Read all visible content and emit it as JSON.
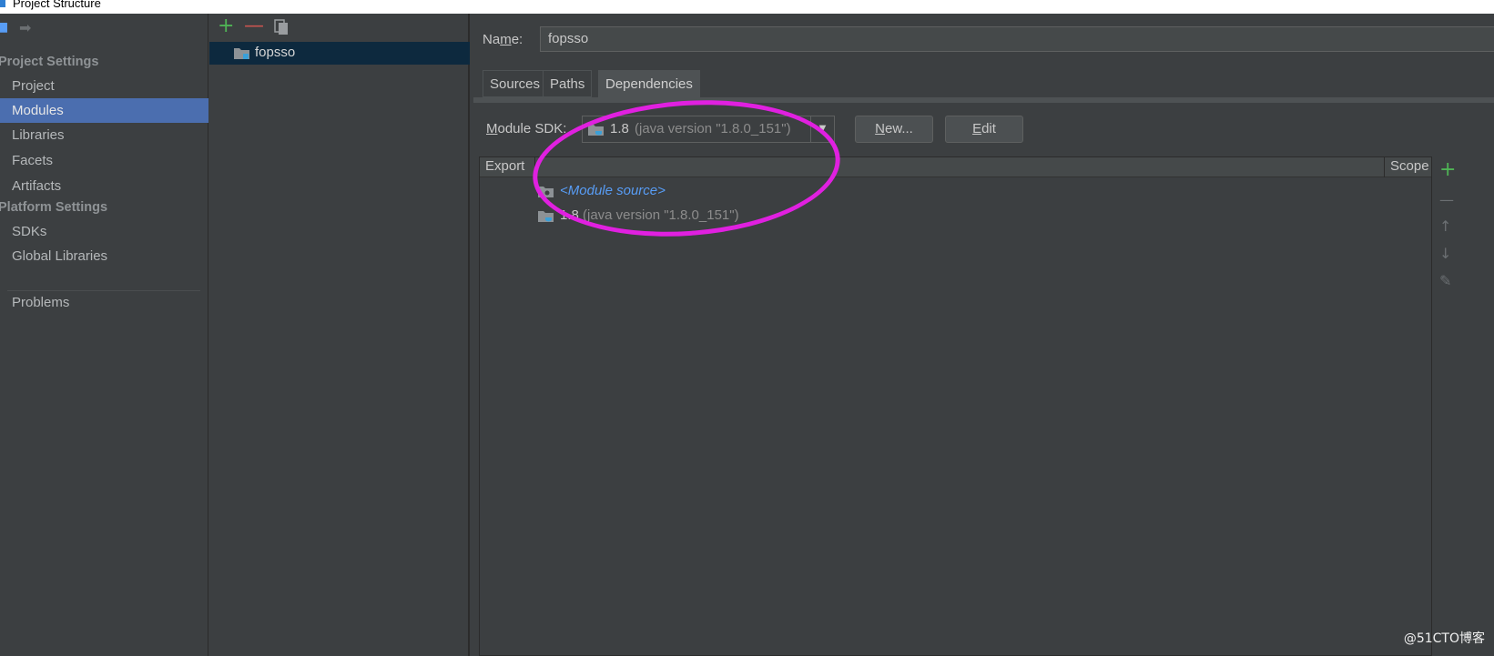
{
  "window": {
    "title": "Project Structure"
  },
  "nav": {
    "project_settings_heading": "Project Settings",
    "platform_settings_heading": "Platform Settings",
    "items": [
      {
        "label": "Project",
        "selected": false
      },
      {
        "label": "Modules",
        "selected": true
      },
      {
        "label": "Libraries",
        "selected": false
      },
      {
        "label": "Facets",
        "selected": false
      },
      {
        "label": "Artifacts",
        "selected": false
      }
    ],
    "platform_items": [
      {
        "label": "SDKs"
      },
      {
        "label": "Global Libraries"
      }
    ],
    "problems_label": "Problems"
  },
  "modules": {
    "toolbar": {
      "add_icon": "plus-icon",
      "remove_icon": "minus-icon",
      "copy_icon": "copy-icon"
    },
    "items": [
      {
        "label": "fopsso",
        "selected": true
      }
    ]
  },
  "detail": {
    "name_label_prefix": "Na",
    "name_label_mnemonic": "m",
    "name_label_suffix": "e:",
    "name_value": "fopsso",
    "tabs": [
      {
        "label": "Sources",
        "active": false
      },
      {
        "label": "Paths",
        "active": false
      },
      {
        "label": "Dependencies",
        "active": true
      }
    ],
    "sdk_label_mnemonic": "M",
    "sdk_label_rest": "odule SDK:",
    "sdk_value": "1.8",
    "sdk_detail": "(java version \"1.8.0_151\")",
    "new_button_mnemonic": "N",
    "new_button_rest": "ew...",
    "edit_button_mnemonic": "E",
    "edit_button_rest": "dit"
  },
  "dependencies": {
    "columns": {
      "export": "Export",
      "scope": "Scope"
    },
    "rows": [
      {
        "label": "<Module source>",
        "detail": "",
        "icon": "folder-icon"
      },
      {
        "label": "1.8",
        "detail": "(java version \"1.8.0_151\")",
        "icon": "jdk-icon"
      }
    ]
  },
  "colors": {
    "background": "#3c3f41",
    "selection": "#4b6eaf",
    "module_selection": "#0d293e",
    "link": "#589df6",
    "annotation": "#e020e0",
    "add_green": "#4fb355",
    "remove_red": "#c75450"
  },
  "watermark": "@51CTO博客"
}
